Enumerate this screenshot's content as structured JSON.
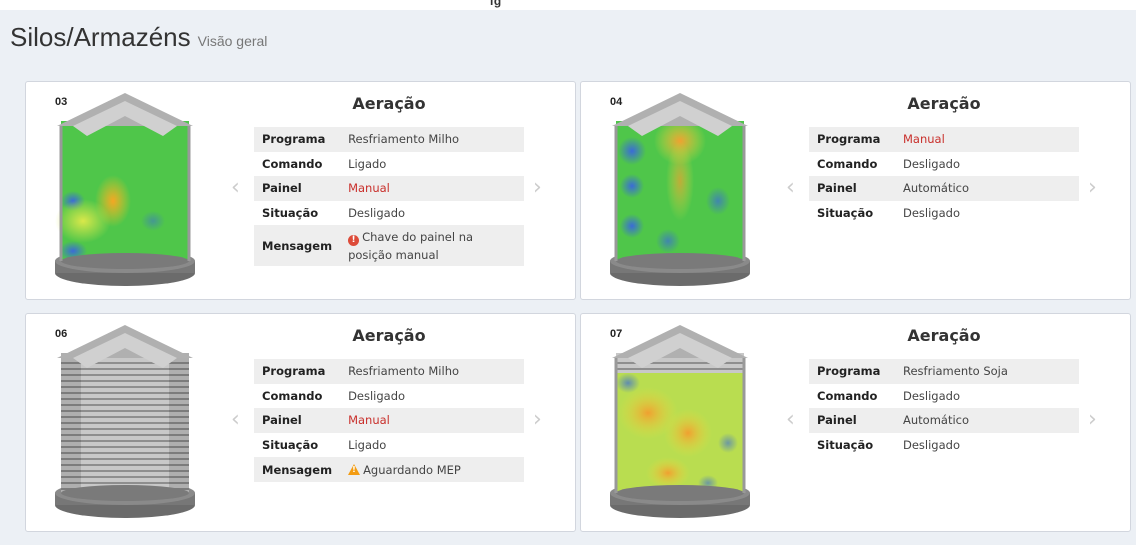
{
  "top_strip_text": "ig",
  "header": {
    "title": "Silos/Armazéns",
    "subtitle": "Visão geral"
  },
  "cards": [
    {
      "number": "03",
      "title": "Aeração",
      "prev": "‹",
      "next": "›",
      "rows": [
        {
          "label": "Programa",
          "value": "Resfriamento Milho"
        },
        {
          "label": "Comando",
          "value": "Ligado"
        },
        {
          "label": "Painel",
          "value": "Manual"
        },
        {
          "label": "Situação",
          "value": "Desligado"
        },
        {
          "label": "Mensagem",
          "value": "Chave do painel na posição manual"
        }
      ]
    },
    {
      "number": "04",
      "title": "Aeração",
      "prev": "‹",
      "next": "›",
      "rows": [
        {
          "label": "Programa",
          "value": "Manual"
        },
        {
          "label": "Comando",
          "value": "Desligado"
        },
        {
          "label": "Painel",
          "value": "Automático"
        },
        {
          "label": "Situação",
          "value": "Desligado"
        }
      ]
    },
    {
      "number": "06",
      "title": "Aeração",
      "prev": "‹",
      "next": "›",
      "rows": [
        {
          "label": "Programa",
          "value": "Resfriamento Milho"
        },
        {
          "label": "Comando",
          "value": "Desligado"
        },
        {
          "label": "Painel",
          "value": "Manual"
        },
        {
          "label": "Situação",
          "value": "Ligado"
        },
        {
          "label": "Mensagem",
          "value": "Aguardando MEP"
        }
      ]
    },
    {
      "number": "07",
      "title": "Aeração",
      "prev": "‹",
      "next": "›",
      "rows": [
        {
          "label": "Programa",
          "value": "Resfriamento Soja"
        },
        {
          "label": "Comando",
          "value": "Desligado"
        },
        {
          "label": "Painel",
          "value": "Automático"
        },
        {
          "label": "Situação",
          "value": "Desligado"
        }
      ]
    }
  ],
  "colors": {
    "alert_red": "#c9302c",
    "warning_orange": "#f39c12",
    "error_icon": "#dd4b39"
  },
  "icons": {
    "message_error": "exclamation-circle-icon",
    "message_warning": "warning-triangle-icon"
  }
}
